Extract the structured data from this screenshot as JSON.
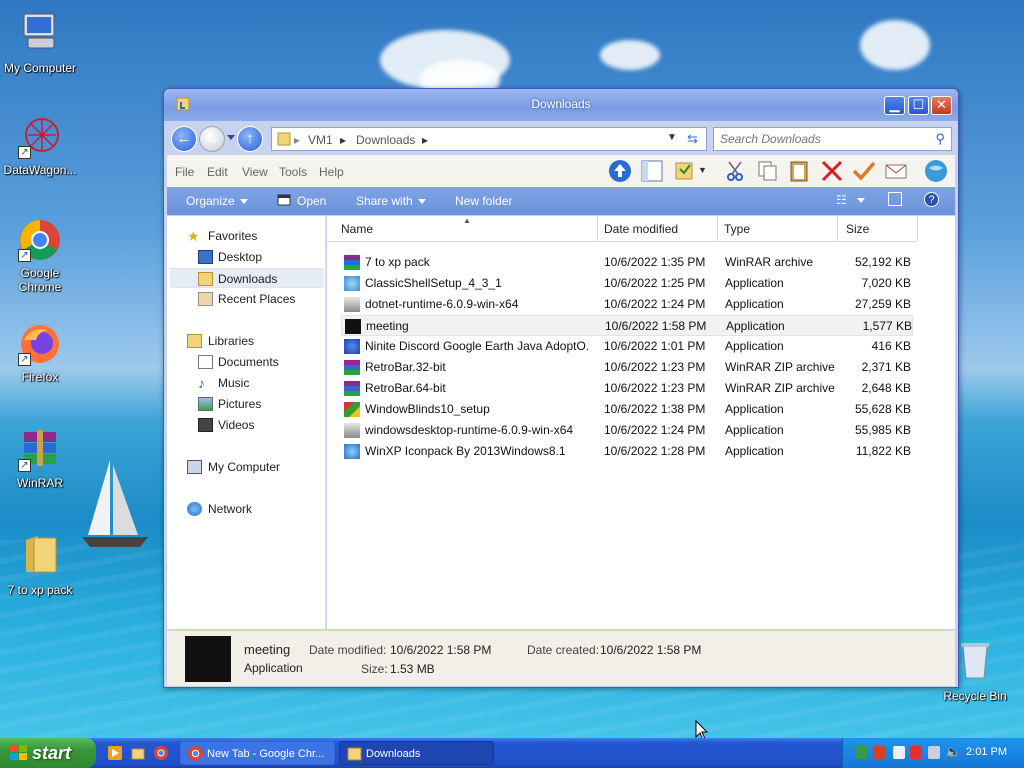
{
  "desktop": {
    "icons": [
      {
        "label": "My Computer"
      },
      {
        "label": "DataWagon..."
      },
      {
        "label": "Google Chrome"
      },
      {
        "label": "Firefox"
      },
      {
        "label": "WinRAR"
      },
      {
        "label": "7 to xp pack"
      },
      {
        "label": "Recycle Bin"
      }
    ]
  },
  "window": {
    "title": "Downloads",
    "breadcrumb": [
      "VM1",
      "Downloads"
    ],
    "search_placeholder": "Search Downloads",
    "menu": [
      "File",
      "Edit",
      "View",
      "Tools",
      "Help"
    ],
    "commands": {
      "organize": "Organize",
      "open": "Open",
      "share": "Share with",
      "new_folder": "New folder"
    },
    "nav": {
      "favorites": "Favorites",
      "desktop": "Desktop",
      "downloads": "Downloads",
      "recent": "Recent Places",
      "libraries": "Libraries",
      "documents": "Documents",
      "music": "Music",
      "pictures": "Pictures",
      "videos": "Videos",
      "computer": "My Computer",
      "network": "Network"
    },
    "columns": {
      "name": "Name",
      "date": "Date modified",
      "type": "Type",
      "size": "Size"
    },
    "files": [
      {
        "name": "7 to xp pack",
        "date": "10/6/2022 1:35 PM",
        "type": "WinRAR archive",
        "size": "52,192 KB",
        "icon": "winrar-icon"
      },
      {
        "name": "ClassicShellSetup_4_3_1",
        "date": "10/6/2022 1:25 PM",
        "type": "Application",
        "size": "7,020 KB",
        "icon": "shell-icon"
      },
      {
        "name": "dotnet-runtime-6.0.9-win-x64",
        "date": "10/6/2022 1:24 PM",
        "type": "Application",
        "size": "27,259 KB",
        "icon": "installer-icon"
      },
      {
        "name": "meeting",
        "date": "10/6/2022 1:58 PM",
        "type": "Application",
        "size": "1,577 KB",
        "icon": "black-app-icon"
      },
      {
        "name": "Ninite Discord Google Earth Java AdoptO...",
        "date": "10/6/2022 1:01 PM",
        "type": "Application",
        "size": "416 KB",
        "icon": "ninite-icon"
      },
      {
        "name": "RetroBar.32-bit",
        "date": "10/6/2022 1:23 PM",
        "type": "WinRAR ZIP archive",
        "size": "2,371 KB",
        "icon": "winrar-icon"
      },
      {
        "name": "RetroBar.64-bit",
        "date": "10/6/2022 1:23 PM",
        "type": "WinRAR ZIP archive",
        "size": "2,648 KB",
        "icon": "winrar-icon"
      },
      {
        "name": "WindowBlinds10_setup",
        "date": "10/6/2022 1:38 PM",
        "type": "Application",
        "size": "55,628 KB",
        "icon": "windowblinds-icon"
      },
      {
        "name": "windowsdesktop-runtime-6.0.9-win-x64",
        "date": "10/6/2022 1:24 PM",
        "type": "Application",
        "size": "55,985 KB",
        "icon": "installer-icon"
      },
      {
        "name": "WinXP Iconpack By 2013Windows8.1",
        "date": "10/6/2022 1:28 PM",
        "type": "Application",
        "size": "11,822 KB",
        "icon": "iconpack-icon"
      }
    ],
    "details": {
      "name": "meeting",
      "kind": "Application",
      "date_modified_label": "Date modified:",
      "date_modified": "10/6/2022 1:58 PM",
      "date_created_label": "Date created:",
      "date_created": "10/6/2022 1:58 PM",
      "size_label": "Size:",
      "size": "1.53 MB"
    }
  },
  "taskbar": {
    "start": "start",
    "tasks": [
      "New Tab - Google Chr...",
      "Downloads"
    ],
    "clock": "2:01 PM"
  },
  "colors": {
    "accent": "#2457d3",
    "window_frame": "#c7d3ee",
    "cmdbar": "#7fa3e4"
  }
}
